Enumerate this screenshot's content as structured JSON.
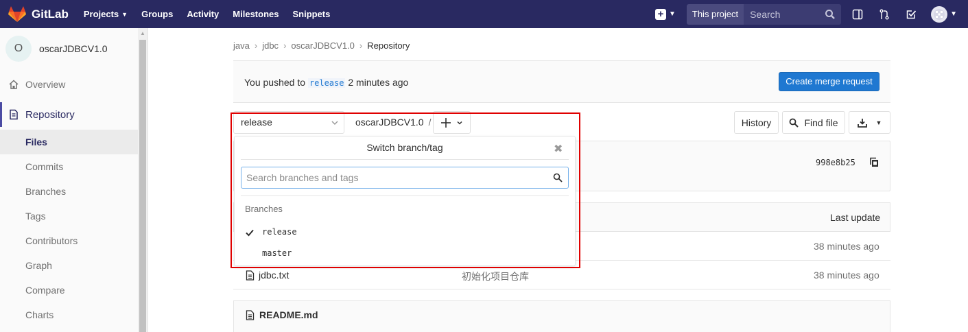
{
  "app": {
    "name": "GitLab"
  },
  "topnav": {
    "items": [
      {
        "label": "Projects"
      },
      {
        "label": "Groups"
      },
      {
        "label": "Activity"
      },
      {
        "label": "Milestones"
      },
      {
        "label": "Snippets"
      }
    ],
    "search_scope": "This project",
    "search_placeholder": "Search"
  },
  "sidebar": {
    "project_initial": "O",
    "project_name": "oscarJDBCV1.0",
    "overview": "Overview",
    "repository": "Repository",
    "sub_items": [
      "Files",
      "Commits",
      "Branches",
      "Tags",
      "Contributors",
      "Graph",
      "Compare",
      "Charts"
    ],
    "active": "Files"
  },
  "breadcrumb": [
    "java",
    "jdbc",
    "oscarJDBCV1.0",
    "Repository"
  ],
  "push": {
    "prefix": "You pushed to",
    "branch": "release",
    "suffix": "2 minutes ago",
    "button": "Create merge request"
  },
  "tree": {
    "branch": "release",
    "path_root": "oscarJDBCV1.0",
    "path_sep": "/",
    "history": "History",
    "find_file": "Find file"
  },
  "commit": {
    "sha": "998e8b25"
  },
  "table": {
    "last_update_header": "Last update",
    "rows": [
      {
        "name": "",
        "message": "",
        "time": "38 minutes ago"
      },
      {
        "name": "jdbc.txt",
        "message": "初始化项目仓库",
        "time": "38 minutes ago"
      }
    ]
  },
  "readme": {
    "title": "README.md"
  },
  "dropdown": {
    "title": "Switch branch/tag",
    "search_placeholder": "Search branches and tags",
    "section": "Branches",
    "items": [
      "release",
      "master"
    ],
    "selected": "release"
  },
  "colors": {
    "navbar": "#292961",
    "primary": "#1f78d1",
    "highlight": "#e00000"
  }
}
